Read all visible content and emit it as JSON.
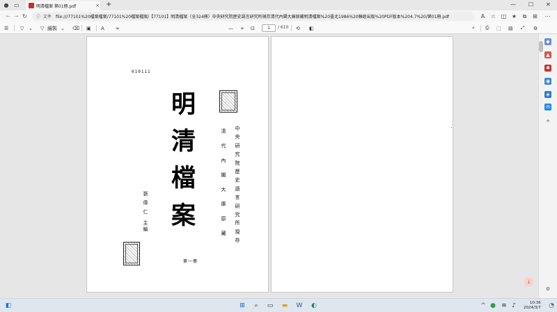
{
  "browser": {
    "tab": {
      "title": "明清檔案 第01冊.pdf",
      "close": "×"
    },
    "new_tab": "+",
    "window_controls": {
      "minimize": "—",
      "maximize": "☐",
      "close": "✕"
    },
    "address": {
      "file_label": "文件",
      "url": "file:///77101%20檔案檔案/77101%20檔案檔案/【77101】明清檔案（全324冊）中央研究院歷史語言研究所現存清代內閣大庫原藏明清檔案%20臺北1986%20聯經出版%20PDF版本%204.7%20/第01冊.pdf"
    }
  },
  "pdf_toolbar": {
    "draw_label": "繪製",
    "zoom_minus": "—",
    "zoom_plus": "+",
    "page_current": "1",
    "page_total": "/ 610"
  },
  "document": {
    "page1": {
      "code": "010111",
      "title_chars": [
        "明",
        "清",
        "檔",
        "案"
      ],
      "col_institute_right": "中央研究院歷史語言研究所現存",
      "col_institute_left": "清代內閣大庫原藏",
      "editor": "張偉仁",
      "editor_role": "主編",
      "volume": "第一冊"
    }
  },
  "taskbar": {
    "time": "10:36",
    "date": "2024/3/7"
  }
}
